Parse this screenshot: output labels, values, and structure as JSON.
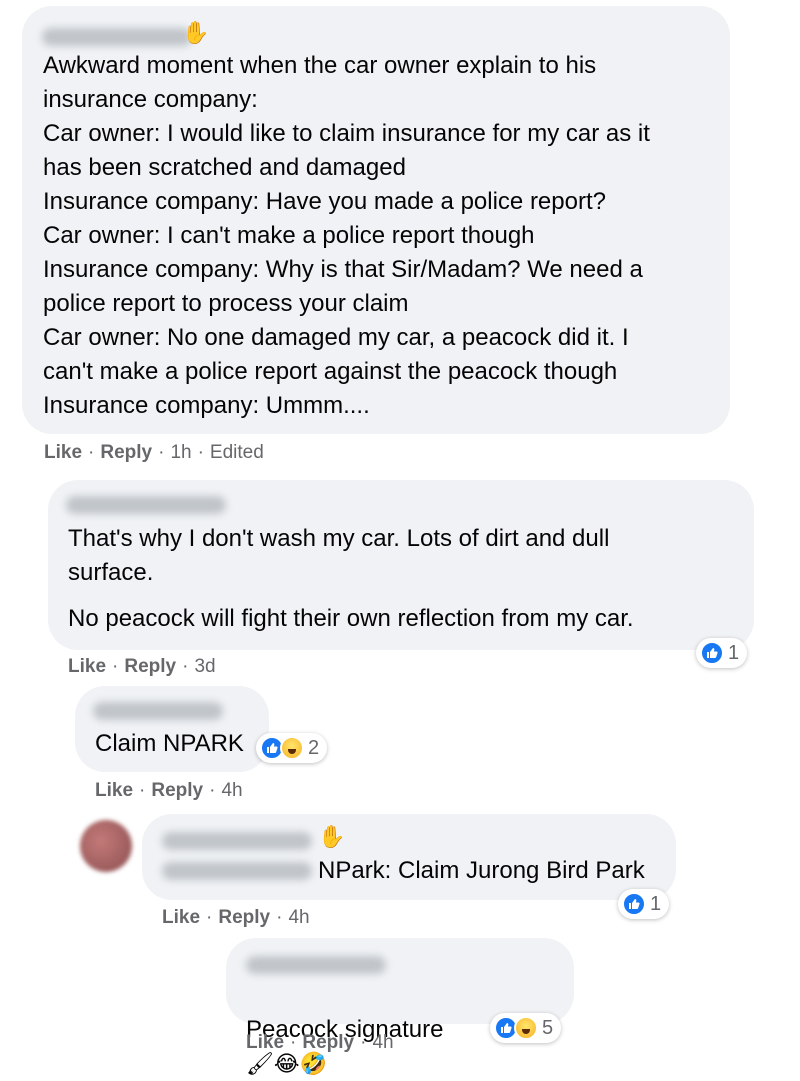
{
  "comments": [
    {
      "text": "Awkward moment when the car owner explain to his\ninsurance company:\nCar owner: I would like to claim insurance for my car as it\nhas been scratched and damaged\nInsurance company: Have you made a police report?\nCar owner: I can't make a police report though\nInsurance company: Why is that Sir/Madam? We need a\npolice report to process your claim\nCar owner: No one damaged my car, a peacock did it. I\ncan't make a police report against the peacock though\nInsurance company: Ummm....",
      "like": "Like",
      "reply": "Reply",
      "time": "1h",
      "extra": "Edited"
    },
    {
      "text": "That's why I don't wash my car. Lots of dirt and dull\nsurface.",
      "text2": "No peacock will fight their own reflection from my car.",
      "like": "Like",
      "reply": "Reply",
      "time": "3d",
      "reaction_count": "1"
    },
    {
      "text": "Claim NPARK",
      "like": "Like",
      "reply": "Reply",
      "time": "4h",
      "reaction_count": "2"
    },
    {
      "text": "NPark: Claim Jurong Bird Park",
      "like": "Like",
      "reply": "Reply",
      "time": "4h",
      "reaction_count": "1"
    },
    {
      "text": "Peacock signature",
      "like": "Like",
      "reply": "Reply",
      "time": "4h",
      "reaction_count": "5",
      "emoji": "🖌😂🤣"
    }
  ],
  "separator": "·",
  "colors": {
    "bubble": "#f0f2f5",
    "secondary_text": "#65676b",
    "like_blue": "#1877f2"
  },
  "icons": [
    "wave-icon",
    "like-reaction-icon",
    "haha-reaction-icon"
  ]
}
